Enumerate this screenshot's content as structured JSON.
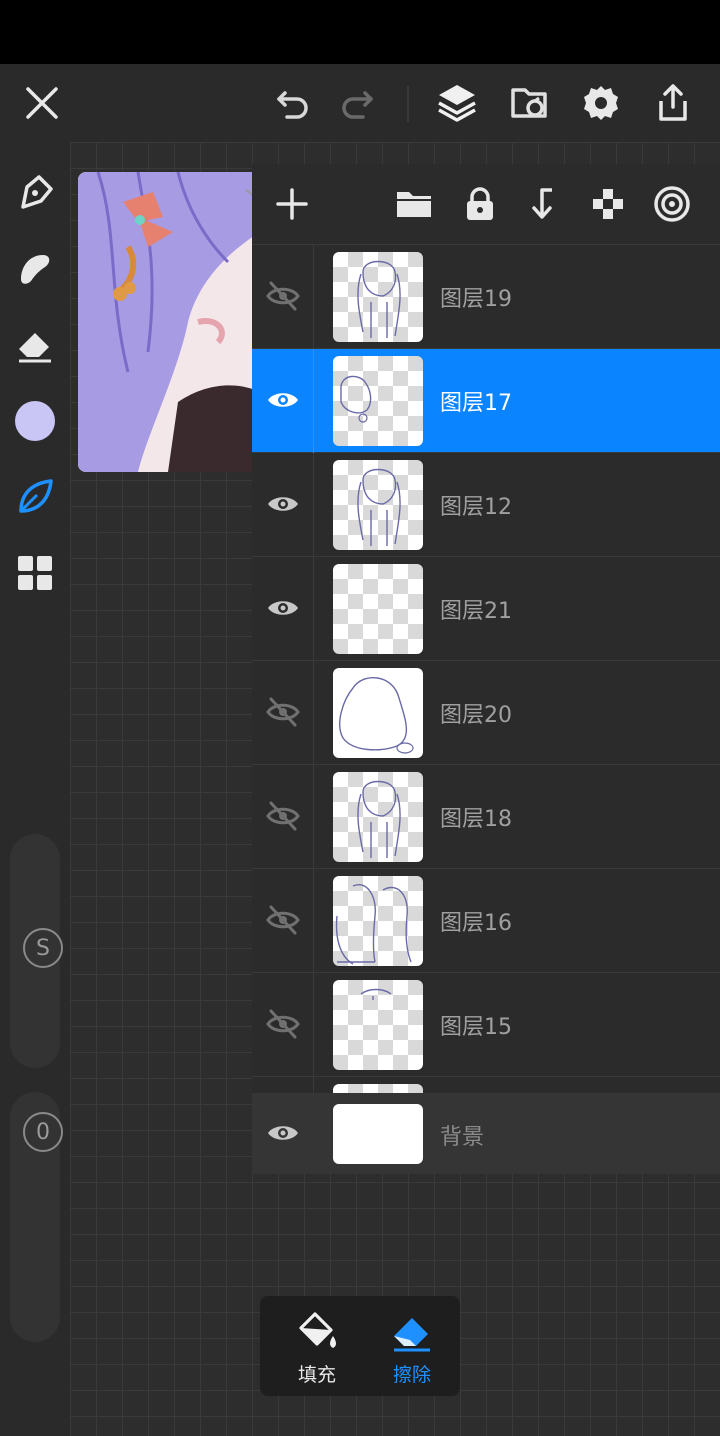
{
  "topbar": {
    "icons": [
      "close-icon",
      "undo-icon",
      "redo-icon",
      "layers-icon",
      "gallery-import-icon",
      "settings-icon",
      "export-icon"
    ]
  },
  "leftbar": {
    "tools": [
      "pen-icon",
      "smudge-icon",
      "eraser-icon",
      "color-swatch",
      "leaf-brush-icon",
      "grid-menu-icon"
    ],
    "color_swatch_hex": "#c9c5f4",
    "size_slider_label": "S",
    "opacity_slider_label": "0"
  },
  "layers_panel": {
    "toolbar_icons": [
      "add-icon",
      "folder-icon",
      "lock-icon",
      "merge-down-icon",
      "checker-icon",
      "target-icon"
    ],
    "layers": [
      {
        "name": "图层19",
        "visible": false,
        "selected": false
      },
      {
        "name": "图层17",
        "visible": true,
        "selected": true
      },
      {
        "name": "图层12",
        "visible": true,
        "selected": false
      },
      {
        "name": "图层21",
        "visible": true,
        "selected": false
      },
      {
        "name": "图层20",
        "visible": false,
        "selected": false
      },
      {
        "name": "图层18",
        "visible": false,
        "selected": false
      },
      {
        "name": "图层16",
        "visible": false,
        "selected": false
      },
      {
        "name": "图层15",
        "visible": false,
        "selected": false
      }
    ],
    "background_layer": {
      "name": "背景",
      "visible": true
    }
  },
  "tool_popup": {
    "fill_label": "填充",
    "erase_label": "擦除",
    "active": "erase"
  },
  "colors": {
    "accent": "#0a84ff",
    "eraser_active": "#1e90ff",
    "panel_bg": "#2b2b2b"
  }
}
